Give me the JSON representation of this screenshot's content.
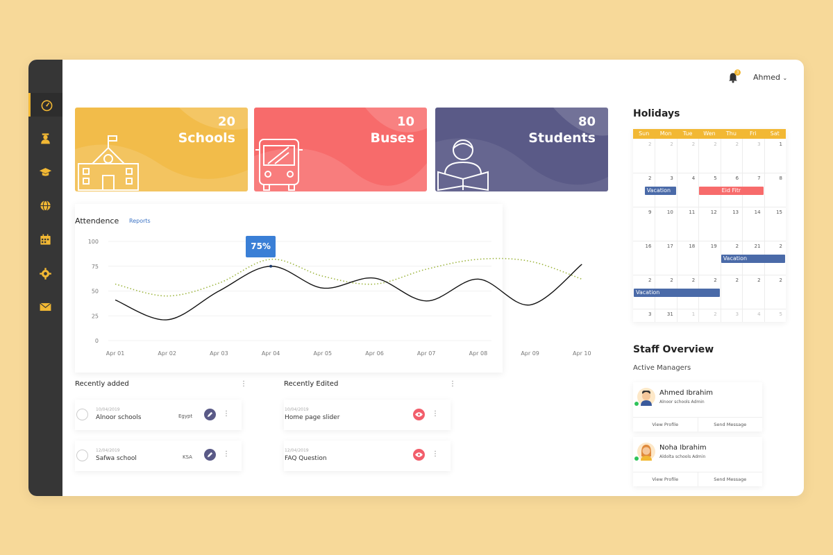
{
  "header": {
    "user_name": "Ahmed",
    "notification_count": "3"
  },
  "sidebar": {
    "items": [
      {
        "icon": "speedometer-icon",
        "active": true
      },
      {
        "icon": "user-icon",
        "active": false
      },
      {
        "icon": "graduation-cap-icon",
        "active": false
      },
      {
        "icon": "globe-icon",
        "active": false
      },
      {
        "icon": "calendar-icon",
        "active": false
      },
      {
        "icon": "gear-icon",
        "active": false
      },
      {
        "icon": "envelope-icon",
        "active": false
      }
    ]
  },
  "stats": [
    {
      "value": "20",
      "label": "Schools",
      "color": "#f2bc4a"
    },
    {
      "value": "10",
      "label": "Buses",
      "color": "#f76b6b"
    },
    {
      "value": "80",
      "label": "Students",
      "color": "#5a5a87"
    }
  ],
  "attendance": {
    "title": "Attendence",
    "link": "Reports",
    "tooltip": "75%"
  },
  "chart_data": {
    "type": "line",
    "title": "Attendence",
    "x": [
      "Apr 01",
      "Apr 02",
      "Apr 03",
      "Apr 04",
      "Apr 05",
      "Apr 06",
      "Apr 07",
      "Apr 08",
      "Apr 09",
      "Apr 10"
    ],
    "ylim": [
      0,
      100
    ],
    "yticks": [
      0,
      25,
      50,
      75,
      100
    ],
    "series": [
      {
        "style": "solid",
        "color": "#111111",
        "values": [
          41,
          21,
          50,
          75,
          53,
          63,
          40,
          62,
          36,
          77
        ]
      },
      {
        "style": "dotted",
        "color": "#9db53f",
        "values": [
          57,
          45,
          58,
          82,
          65,
          57,
          72,
          82,
          80,
          62
        ]
      }
    ],
    "grid": true,
    "legend": "none"
  },
  "recently_added": {
    "title": "Recently added",
    "items": [
      {
        "date": "10/04/2019",
        "name": "Alnoor schools",
        "country": "Egypt"
      },
      {
        "date": "12/04/2019",
        "name": "Safwa school",
        "country": "KSA"
      }
    ]
  },
  "recently_edited": {
    "title": "Recently Edited",
    "items": [
      {
        "date": "10/04/2019",
        "name": "Home page slider"
      },
      {
        "date": "12/04/2019",
        "name": "FAQ Question"
      }
    ]
  },
  "holidays": {
    "title": "Holidays",
    "weekdays": [
      "Sun",
      "Mon",
      "Tue",
      "Wen",
      "Thu",
      "Fri",
      "Sat"
    ],
    "weeks": [
      [
        "2",
        "2",
        "2",
        "2",
        "2",
        "3",
        "1"
      ],
      [
        "2",
        "3",
        "4",
        "5",
        "6",
        "7",
        "8"
      ],
      [
        "9",
        "10",
        "11",
        "12",
        "13",
        "14",
        "15"
      ],
      [
        "16",
        "17",
        "18",
        "19",
        "2",
        "21",
        "2"
      ],
      [
        "2",
        "2",
        "2",
        "2",
        "2",
        "2",
        "2"
      ],
      [
        "3",
        "31",
        "1",
        "2",
        "3",
        "4",
        "5"
      ]
    ],
    "events": [
      {
        "label": "Vacation",
        "color": "#4a6aa8"
      },
      {
        "label": "Eid Fitr",
        "color": "#f76b6b"
      },
      {
        "label": "Vacation",
        "color": "#4a6aa8"
      },
      {
        "label": "Vacation",
        "color": "#4a6aa8"
      }
    ]
  },
  "staff": {
    "title": "Staff Overview",
    "subtitle": "Active Managers",
    "managers": [
      {
        "name": "Ahmed Ibrahim",
        "role": "Alnoor schools Admin",
        "view": "View Profile",
        "message": "Send Message"
      },
      {
        "name": "Noha Ibrahim",
        "role": "Aldolta schools Admin",
        "view": "View Profile",
        "message": "Send Message"
      }
    ]
  }
}
